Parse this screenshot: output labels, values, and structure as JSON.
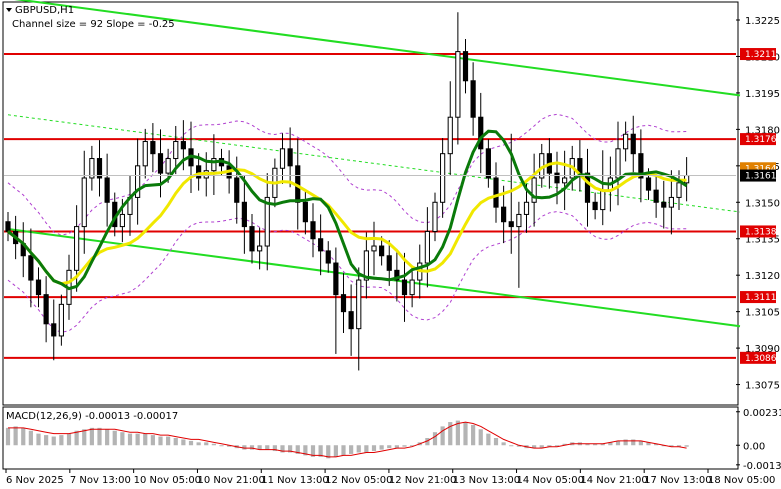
{
  "header": {
    "symbol": "GBPUSD,H1",
    "channel_info": "Channel size = 92  Slope = -0.25",
    "macd_label": "MACD(12,26,9) -0.00013 -0.00017"
  },
  "colors": {
    "background": "#ffffff",
    "candle": "#000000",
    "level_line": "#e00000",
    "channel": "#22dd22",
    "ma_fast": "#0a7a0a",
    "ma_slow": "#f0e800",
    "envelope": "#b040d0",
    "macd_hist": "#b4b4b4",
    "macd_signal": "#e00000",
    "price_box": "#000000",
    "price_box_orange": "#e08000"
  },
  "chart_data": {
    "type": "candlestick",
    "symbol": "GBPUSD",
    "timeframe": "H1",
    "ylim": [
      1.3067,
      1.3232
    ],
    "y_ticks": [
      "1.3225",
      "1.3210",
      "1.3195",
      "1.3180",
      "1.3165",
      "1.3150",
      "1.3135",
      "1.3120",
      "1.3105",
      "1.3090",
      "1.3075"
    ],
    "x_ticks": [
      "6 Nov 2025",
      "7 Nov 13:00",
      "10 Nov 05:00",
      "10 Nov 21:00",
      "11 Nov 13:00",
      "12 Nov 05:00",
      "12 Nov 21:00",
      "13 Nov 13:00",
      "14 Nov 05:00",
      "14 Nov 21:00",
      "17 Nov 13:00",
      "18 Nov 05:00"
    ],
    "current_price": "1.3161",
    "current_price_orange": "1.3164",
    "levels": [
      {
        "label": "1.3211",
        "value": 1.3211
      },
      {
        "label": "1.3176",
        "value": 1.3176
      },
      {
        "label": "1.3138",
        "value": 1.3138
      },
      {
        "label": "1.3111",
        "value": 1.3111
      },
      {
        "label": "1.3086",
        "value": 1.3086
      }
    ],
    "channel_upper": [
      [
        0,
        1.3234
      ],
      [
        96,
        1.3194
      ]
    ],
    "channel_lower": [
      [
        0,
        1.3139
      ],
      [
        96,
        1.3099
      ]
    ],
    "channel_mid": [
      [
        0,
        1.3186
      ],
      [
        96,
        1.3146
      ]
    ],
    "closes": [
      1.3138,
      1.3133,
      1.3128,
      1.3118,
      1.3112,
      1.31,
      1.3095,
      1.3108,
      1.3122,
      1.314,
      1.316,
      1.3168,
      1.316,
      1.315,
      1.314,
      1.3145,
      1.3152,
      1.3165,
      1.3175,
      1.317,
      1.3162,
      1.3168,
      1.3175,
      1.3172,
      1.3165,
      1.316,
      1.3163,
      1.3168,
      1.3165,
      1.316,
      1.315,
      1.314,
      1.313,
      1.3132,
      1.3152,
      1.3164,
      1.3172,
      1.3165,
      1.315,
      1.3142,
      1.3135,
      1.313,
      1.3125,
      1.3112,
      1.3105,
      1.3098,
      1.3118,
      1.313,
      1.3132,
      1.3128,
      1.3122,
      1.3118,
      1.3112,
      1.3118,
      1.3125,
      1.3138,
      1.315,
      1.317,
      1.3185,
      1.3212,
      1.32,
      1.3185,
      1.3172,
      1.316,
      1.3148,
      1.3142,
      1.314,
      1.3145,
      1.315,
      1.316,
      1.317,
      1.3162,
      1.3158,
      1.316,
      1.3168,
      1.3162,
      1.315,
      1.3147,
      1.3155,
      1.316,
      1.3172,
      1.3178,
      1.317,
      1.316,
      1.3155,
      1.315,
      1.3148,
      1.3152,
      1.3158,
      1.3161
    ],
    "macd_ylim": [
      -0.0015,
      0.0025
    ],
    "macd_ticks": [
      "0.00231",
      "0.00",
      "-0.00135"
    ],
    "macd_hist": [
      0.0012,
      0.0013,
      0.0012,
      0.001,
      0.0008,
      0.0007,
      0.0006,
      0.0007,
      0.0008,
      0.001,
      0.0011,
      0.0012,
      0.0012,
      0.0011,
      0.001,
      0.0009,
      0.0008,
      0.0008,
      0.0008,
      0.0007,
      0.0006,
      0.0006,
      0.0005,
      0.0004,
      0.0003,
      0.0002,
      0.0002,
      0.0001,
      0.0,
      -0.0001,
      -0.0002,
      -0.0003,
      -0.0003,
      -0.0003,
      -0.0003,
      -0.0004,
      -0.0005,
      -0.0005,
      -0.0006,
      -0.0007,
      -0.0008,
      -0.0008,
      -0.0009,
      -0.0008,
      -0.0007,
      -0.0006,
      -0.0005,
      -0.0005,
      -0.0004,
      -0.0003,
      -0.0002,
      -0.0002,
      -0.0001,
      0.0,
      0.0002,
      0.0005,
      0.0009,
      0.0013,
      0.0016,
      0.0017,
      0.0016,
      0.0014,
      0.0011,
      0.0008,
      0.0005,
      0.0002,
      0.0,
      -0.0001,
      -0.0002,
      -0.0002,
      -0.0002,
      -0.0001,
      0.0,
      0.0001,
      0.0002,
      0.0002,
      0.0001,
      0.0001,
      0.0001,
      0.0002,
      0.0003,
      0.0004,
      0.0004,
      0.0003,
      0.0002,
      0.0001,
      0.0,
      -0.0001,
      -0.0001,
      -0.0001
    ],
    "macd_signal": [
      0.0012,
      0.0012,
      0.0012,
      0.0011,
      0.001,
      0.0009,
      0.0008,
      0.0008,
      0.0008,
      0.0009,
      0.001,
      0.0011,
      0.0011,
      0.0011,
      0.0011,
      0.001,
      0.0009,
      0.0009,
      0.0008,
      0.0008,
      0.0007,
      0.0007,
      0.0006,
      0.0005,
      0.0004,
      0.0004,
      0.0003,
      0.0002,
      0.0001,
      0.0,
      -0.0001,
      -0.0002,
      -0.0002,
      -0.0003,
      -0.0003,
      -0.0003,
      -0.0004,
      -0.0004,
      -0.0005,
      -0.0006,
      -0.0007,
      -0.0007,
      -0.0008,
      -0.0008,
      -0.0007,
      -0.0007,
      -0.0006,
      -0.0005,
      -0.0005,
      -0.0004,
      -0.0003,
      -0.0002,
      -0.0002,
      -0.0001,
      0.0001,
      0.0003,
      0.0006,
      0.001,
      0.0013,
      0.0015,
      0.0016,
      0.0015,
      0.0013,
      0.001,
      0.0007,
      0.0004,
      0.0002,
      0.0,
      -0.0001,
      -0.0002,
      -0.0002,
      -0.0001,
      -0.0001,
      0.0,
      0.0001,
      0.0001,
      0.0001,
      0.0001,
      0.0001,
      0.0002,
      0.0003,
      0.0003,
      0.0003,
      0.0003,
      0.0002,
      0.0001,
      0.0,
      -0.0001,
      -0.0001,
      -0.0002
    ]
  }
}
